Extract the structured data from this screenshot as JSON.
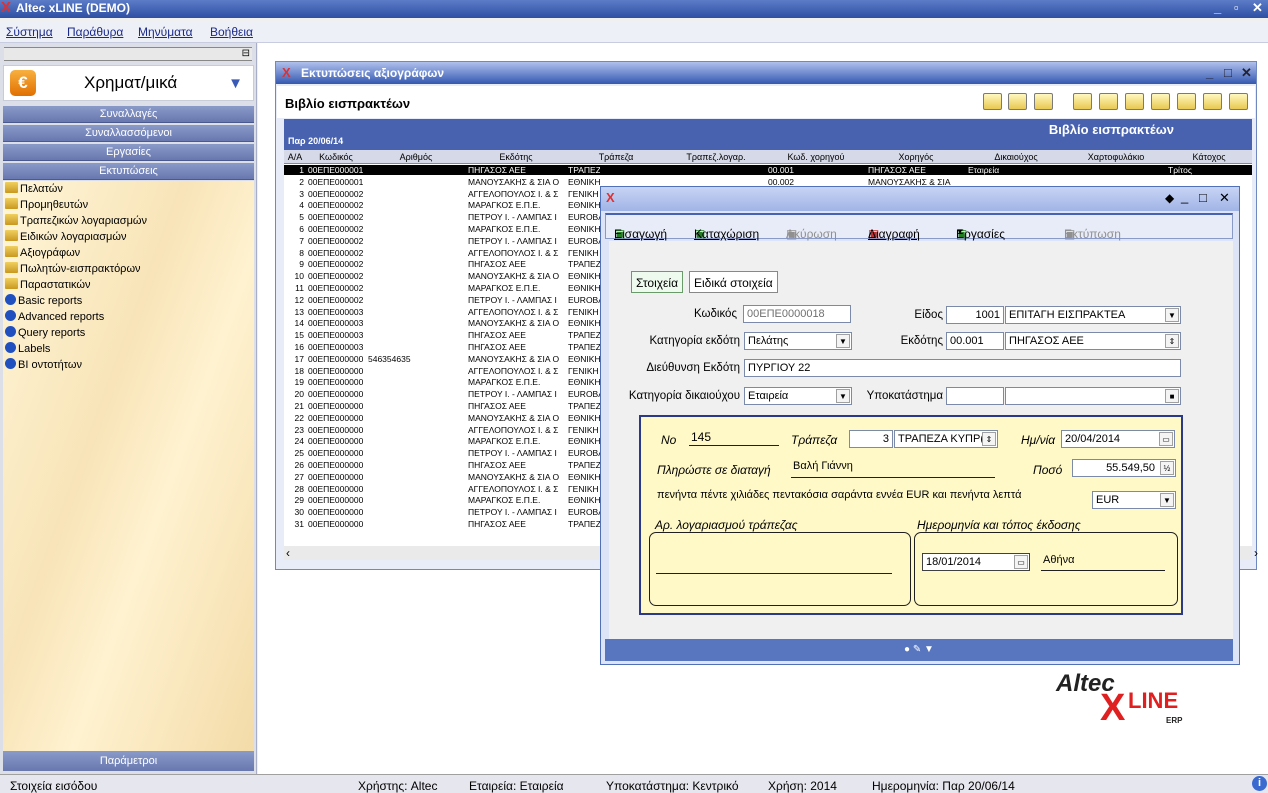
{
  "app": {
    "title": "Altec xLINE (DEMO)"
  },
  "menu": [
    "Σύστημα",
    "Παράθυρα",
    "Μηνύματα",
    "Βοήθεια"
  ],
  "sidebar": {
    "header": "Χρηματ/μικά",
    "sections": [
      "Συναλλαγές",
      "Συναλλασσόμενοι",
      "Εργασίες",
      "Εκτυπώσεις"
    ],
    "items": [
      "Πελατών",
      "Προμηθευτών",
      "Τραπεζικών λογαριασμών",
      "Ειδικών λογαριασμών",
      "Αξιογράφων",
      "Πωλητών-εισπρακτόρων",
      "Παραστατικών",
      "Basic reports",
      "Advanced reports",
      "Query reports",
      "Labels",
      "BI οντοτήτων"
    ],
    "bottom": "Παράμετροι"
  },
  "report_window": {
    "title": "Εκτυπώσεις αξιογράφων",
    "subtitle": "Βιβλίο εισπρακτέων",
    "report_title": "Βιβλίο εισπρακτέων",
    "date": "Παρ 20/06/14",
    "columns": [
      "Α/Α",
      "Κωδικός",
      "Αριθμός",
      "Εκδότης",
      "Τράπεζα",
      "Τραπεζ.λογαρ.",
      "Κωδ. χορηγού",
      "Χορηγός",
      "Δικαιούχος",
      "Χαρτοφυλάκιο",
      "Κάτοχος"
    ],
    "rows": [
      [
        "1",
        "00ΕΠΕ000001",
        "",
        "ΠΗΓΑΣΟΣ ΑΕΕ",
        "ΤΡΑΠΕΖΑ ΚΥΠΡΟΥ",
        "",
        "00.001",
        "ΠΗΓΑΣΟΣ ΑΕΕ",
        "Εταιρεία",
        "",
        "Τρίτος"
      ],
      [
        "2",
        "00ΕΠΕ000001",
        "",
        "ΜΑΝΟΥΣΑΚΗΣ & ΣΙΑ Ο",
        "ΕΘΝΙΚΗ ΤΡΑΠΕΖΑ",
        "",
        "00.002",
        "ΜΑΝΟΥΣΑΚΗΣ & ΣΙΑ",
        "",
        "",
        ""
      ],
      [
        "3",
        "00ΕΠΕ000002",
        "",
        "ΑΓΓΕΛΟΠΟΥΛΟΣ Ι. & Σ",
        "ΓΕΝΙΚΗ",
        "",
        "",
        "",
        "",
        "",
        ""
      ],
      [
        "4",
        "00ΕΠΕ000002",
        "",
        "ΜΑΡΑΓΚΟΣ Ε.Π.Ε.",
        "ΕΘΝΙΚΗ",
        "",
        "",
        "",
        "",
        "",
        ""
      ],
      [
        "5",
        "00ΕΠΕ000002",
        "",
        "ΠΕΤΡΟΥ Ι. - ΛΑΜΠΑΣ Ι",
        "EUROBANK",
        "",
        "",
        "",
        "",
        "",
        ""
      ],
      [
        "6",
        "00ΕΠΕ000002",
        "",
        "ΜΑΡΑΓΚΟΣ Ε.Π.Ε.",
        "ΕΘΝΙΚΗ",
        "",
        "",
        "",
        "",
        "",
        ""
      ],
      [
        "7",
        "00ΕΠΕ000002",
        "",
        "ΠΕΤΡΟΥ Ι. - ΛΑΜΠΑΣ Ι",
        "EUROBANK",
        "",
        "",
        "",
        "",
        "",
        ""
      ],
      [
        "8",
        "00ΕΠΕ000002",
        "",
        "ΑΓΓΕΛΟΠΟΥΛΟΣ Ι. & Σ",
        "ΓΕΝΙΚΗ",
        "",
        "",
        "",
        "",
        "",
        ""
      ],
      [
        "9",
        "00ΕΠΕ000002",
        "",
        "ΠΗΓΑΣΟΣ ΑΕΕ",
        "ΤΡΑΠΕΖΑ",
        "",
        "",
        "",
        "",
        "",
        ""
      ],
      [
        "10",
        "00ΕΠΕ000002",
        "",
        "ΜΑΝΟΥΣΑΚΗΣ & ΣΙΑ Ο",
        "ΕΘΝΙΚΗ",
        "",
        "",
        "",
        "",
        "",
        ""
      ],
      [
        "11",
        "00ΕΠΕ000002",
        "",
        "ΜΑΡΑΓΚΟΣ Ε.Π.Ε.",
        "ΕΘΝΙΚΗ",
        "",
        "",
        "",
        "",
        "",
        ""
      ],
      [
        "12",
        "00ΕΠΕ000002",
        "",
        "ΠΕΤΡΟΥ Ι. - ΛΑΜΠΑΣ Ι",
        "EUROBANK",
        "",
        "",
        "",
        "",
        "",
        ""
      ],
      [
        "13",
        "00ΕΠΕ000003",
        "",
        "ΑΓΓΕΛΟΠΟΥΛΟΣ Ι. & Σ",
        "ΓΕΝΙΚΗ",
        "",
        "",
        "",
        "",
        "",
        ""
      ],
      [
        "14",
        "00ΕΠΕ000003",
        "",
        "ΜΑΝΟΥΣΑΚΗΣ & ΣΙΑ Ο",
        "ΕΘΝΙΚΗ",
        "",
        "",
        "",
        "",
        "",
        ""
      ],
      [
        "15",
        "00ΕΠΕ000003",
        "",
        "ΠΗΓΑΣΟΣ ΑΕΕ",
        "ΤΡΑΠΕΖΑ",
        "",
        "",
        "",
        "",
        "",
        ""
      ],
      [
        "16",
        "00ΕΠΕ000003",
        "",
        "ΠΗΓΑΣΟΣ ΑΕΕ",
        "ΤΡΑΠΕΖΑ",
        "",
        "",
        "",
        "",
        "",
        ""
      ],
      [
        "17",
        "00ΕΠΕ000000",
        "546354635",
        "ΜΑΝΟΥΣΑΚΗΣ & ΣΙΑ Ο",
        "ΕΘΝΙΚΗ",
        "",
        "",
        "",
        "",
        "",
        ""
      ],
      [
        "18",
        "00ΕΠΕ000000",
        "",
        "ΑΓΓΕΛΟΠΟΥΛΟΣ Ι. & Σ",
        "ΓΕΝΙΚΗ",
        "",
        "",
        "",
        "",
        "",
        ""
      ],
      [
        "19",
        "00ΕΠΕ000000",
        "",
        "ΜΑΡΑΓΚΟΣ Ε.Π.Ε.",
        "ΕΘΝΙΚΗ",
        "",
        "",
        "",
        "",
        "",
        ""
      ],
      [
        "20",
        "00ΕΠΕ000000",
        "",
        "ΠΕΤΡΟΥ Ι. - ΛΑΜΠΑΣ Ι",
        "EUROBANK",
        "",
        "",
        "",
        "",
        "",
        ""
      ],
      [
        "21",
        "00ΕΠΕ000000",
        "",
        "ΠΗΓΑΣΟΣ ΑΕΕ",
        "ΤΡΑΠΕΖΑ",
        "",
        "",
        "",
        "",
        "",
        ""
      ],
      [
        "22",
        "00ΕΠΕ000000",
        "",
        "ΜΑΝΟΥΣΑΚΗΣ & ΣΙΑ Ο",
        "ΕΘΝΙΚΗ",
        "",
        "",
        "",
        "",
        "",
        ""
      ],
      [
        "23",
        "00ΕΠΕ000000",
        "",
        "ΑΓΓΕΛΟΠΟΥΛΟΣ Ι. & Σ",
        "ΓΕΝΙΚΗ",
        "",
        "",
        "",
        "",
        "",
        ""
      ],
      [
        "24",
        "00ΕΠΕ000000",
        "",
        "ΜΑΡΑΓΚΟΣ Ε.Π.Ε.",
        "ΕΘΝΙΚΗ",
        "",
        "",
        "",
        "",
        "",
        ""
      ],
      [
        "25",
        "00ΕΠΕ000000",
        "",
        "ΠΕΤΡΟΥ Ι. - ΛΑΜΠΑΣ Ι",
        "EUROBANK",
        "",
        "",
        "",
        "",
        "",
        ""
      ],
      [
        "26",
        "00ΕΠΕ000000",
        "",
        "ΠΗΓΑΣΟΣ ΑΕΕ",
        "ΤΡΑΠΕΖΑ",
        "",
        "",
        "",
        "",
        "",
        ""
      ],
      [
        "27",
        "00ΕΠΕ000000",
        "",
        "ΜΑΝΟΥΣΑΚΗΣ & ΣΙΑ Ο",
        "ΕΘΝΙΚΗ",
        "",
        "",
        "",
        "",
        "",
        ""
      ],
      [
        "28",
        "00ΕΠΕ000000",
        "",
        "ΑΓΓΕΛΟΠΟΥΛΟΣ Ι. & Σ",
        "ΓΕΝΙΚΗ",
        "",
        "",
        "",
        "",
        "",
        ""
      ],
      [
        "29",
        "00ΕΠΕ000000",
        "",
        "ΜΑΡΑΓΚΟΣ Ε.Π.Ε.",
        "ΕΘΝΙΚΗ",
        "",
        "",
        "",
        "",
        "",
        ""
      ],
      [
        "30",
        "00ΕΠΕ000000",
        "",
        "ΠΕΤΡΟΥ Ι. - ΛΑΜΠΑΣ Ι",
        "EUROBANK",
        "",
        "",
        "",
        "",
        "",
        ""
      ],
      [
        "31",
        "00ΕΠΕ000000",
        "",
        "ΠΗΓΑΣΟΣ ΑΕΕ",
        "ΤΡΑΠΕΖΑ",
        "",
        "",
        "",
        "",
        "",
        ""
      ]
    ]
  },
  "dialog": {
    "toolbar": {
      "insert": "Εισαγωγή",
      "post": "Καταχώριση",
      "cancel": "Ακύρωση",
      "delete": "Διαγραφή",
      "tasks": "Εργασίες",
      "print": "Εκτύπωση"
    },
    "tabs": [
      "Στοιχεία",
      "Ειδικά στοιχεία"
    ],
    "fields": {
      "code_label": "Κωδικός",
      "code": "00ΕΠΕ0000018",
      "type_label": "Είδος",
      "type_code": "1001",
      "type_name": "ΕΠΙΤΑΓΗ ΕΙΣΠΡΑΚΤΕΑ",
      "issuer_cat_label": "Κατηγορία εκδότη",
      "issuer_cat": "Πελάτης",
      "issuer_label": "Εκδότης",
      "issuer_code": "00.001",
      "issuer_name": "ΠΗΓΑΣΟΣ ΑΕΕ",
      "issuer_addr_label": "Διεύθυνση Εκδότη",
      "issuer_addr": "ΠΥΡΓΙΟΥ 22",
      "benef_cat_label": "Κατηγορία δικαιούχου",
      "benef_cat": "Εταιρεία",
      "branch_label": "Υποκατάστημα",
      "branch": ""
    },
    "cheque": {
      "no_label": "Νο",
      "no": "145",
      "bank_label": "Τράπεζα",
      "bank_code": "3",
      "bank_name": "ΤΡΑΠΕΖΑ ΚΥΠΡ(",
      "date_label": "Ημ/νία",
      "date": "20/04/2014",
      "pay_label": "Πληρώστε σε διαταγή",
      "payee": "Βαλή Γιάννη",
      "amount_label": "Ποσό",
      "amount": "55.549,50",
      "amount_words": "πενήντα πέντε χιλιάδες πεντακόσια σαράντα εννέα EUR και πενήντα λεπτά",
      "currency": "EUR",
      "account_label": "Αρ. λογαριασμού τράπεζας",
      "issue_label": "Ημερομηνία και τόπος έκδοσης",
      "issue_date": "18/01/2014",
      "issue_place": "Αθήνα"
    }
  },
  "logo": {
    "top": "Altec",
    "x": "X",
    "line": "LINE",
    "erp": "ERP"
  },
  "status": {
    "left": "Στοιχεία εισόδου",
    "user": "Χρήστης: Altec",
    "company": "Εταιρεία: Εταιρεία",
    "branch": "Υποκατάστημα: Κεντρικό",
    "year": "Χρήση: 2014",
    "date": "Ημερομηνία: Παρ 20/06/14"
  },
  "colors": {
    "accent": "#4862b0",
    "cheque_bg": "#fff9c8",
    "selected_row": "#000000"
  }
}
